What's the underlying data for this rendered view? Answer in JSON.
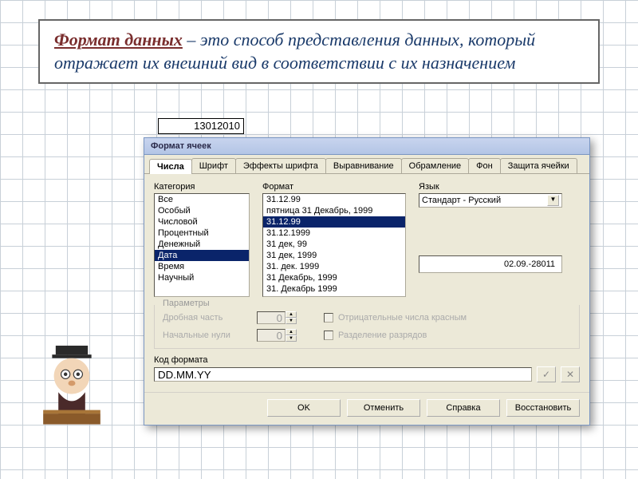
{
  "heading": {
    "title": "Формат данных",
    "body": " – это способ представления данных, который отражает их внешний вид в соответствии с их назначением"
  },
  "formula_cell": "13012010",
  "dialog": {
    "title": "Формат ячеек",
    "tabs": [
      "Числа",
      "Шрифт",
      "Эффекты шрифта",
      "Выравнивание",
      "Обрамление",
      "Фон",
      "Защита ячейки"
    ],
    "active_tab": 0,
    "category_label": "Категория",
    "categories": [
      "Все",
      "Особый",
      "Числовой",
      "Процентный",
      "Денежный",
      "Дата",
      "Время",
      "Научный"
    ],
    "category_selected": 5,
    "format_label": "Формат",
    "formats": [
      "31.12.99",
      "пятница 31 Декабрь, 1999",
      "31.12.99",
      "31.12.1999",
      "31 дек, 99",
      "31 дек, 1999",
      "31. дек. 1999",
      "31 Декабрь, 1999",
      "31. Декабрь 1999"
    ],
    "format_selected": 2,
    "language_label": "Язык",
    "language_value": "Стандарт - Русский",
    "preview": "02.09.-28011",
    "params": {
      "legend": "Параметры",
      "decimal_label": "Дробная часть",
      "decimal_value": "0",
      "leading_label": "Начальные нули",
      "leading_value": "0",
      "neg_red_label": "Отрицательные числа красным",
      "thousands_label": "Разделение разрядов"
    },
    "format_code_label": "Код формата",
    "format_code_value": "DD.MM.YY",
    "buttons": {
      "ok": "OK",
      "cancel": "Отменить",
      "help": "Справка",
      "reset": "Восстановить"
    }
  }
}
